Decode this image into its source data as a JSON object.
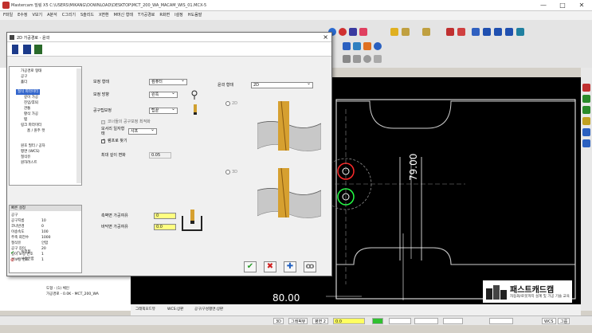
{
  "window": {
    "title": "Mastercam 밀링 X5  C:\\USERS\\MIKANG\\DOWNLOAD\\DESKTOP\\MCT_200_WA_MACAM_WIS_01.MCX-5",
    "minimize": "—",
    "maximize": "□",
    "close": "✕"
  },
  "menu": [
    "F파일",
    "E수정",
    "V보기",
    "A분석",
    "C그리기",
    "S솔리드",
    "X변환",
    "M머신 형태",
    "T가공경로",
    "R화면",
    "I설정",
    "H도움말"
  ],
  "dialog": {
    "title": "2D 가공경로 - 윤곽",
    "close": "×",
    "tree": [
      {
        "label": "가공경로 형태",
        "sel": false
      },
      {
        "label": "공구",
        "sel": false
      },
      {
        "label": "홀더",
        "sel": false
      },
      {
        "label": "절삭 파라미터",
        "sel": true
      },
      {
        "label": "깊이 가공",
        "sel": false
      },
      {
        "label": "진입/후퇴",
        "sel": false
      },
      {
        "label": "관통",
        "sel": false
      },
      {
        "label": "황삭 가공",
        "sel": false
      },
      {
        "label": "탭",
        "sel": false
      },
      {
        "label": "링크 파라미터",
        "sel": false
      },
      {
        "label": "홈 / 원주 컷",
        "sel": false
      },
      {
        "label": "원호 필터 / 공차",
        "sel": false
      },
      {
        "label": "평면 (WCS)",
        "sel": false
      },
      {
        "label": "절삭유",
        "sel": false
      },
      {
        "label": "원하려스트",
        "sel": false
      }
    ],
    "quick": {
      "header": "빠른 설정",
      "rows": [
        {
          "k": "공구",
          "v": ""
        },
        {
          "k": "공구지름",
          "v": "10"
        },
        {
          "k": "코너반경",
          "v": "0"
        },
        {
          "k": "이송속도",
          "v": "100"
        },
        {
          "k": "주축 회전수",
          "v": "1000"
        },
        {
          "k": "절삭유",
          "v": "안함"
        },
        {
          "k": "공구 길이",
          "v": "20"
        },
        {
          "k": "길이 보정 번호",
          "v": "1"
        },
        {
          "k": "경보정 번호",
          "v": "1"
        }
      ],
      "legend_edited": "= 수정됨",
      "legend_disabled": "= 사용안함"
    },
    "params": {
      "comp_type_label": "보정 형태",
      "comp_type_value": "컴퓨터",
      "comp_dir_label": "보정 방향",
      "comp_dir_value": "왼쪽",
      "tip_comp_label": "공구팁보정",
      "tip_comp_value": "팁끝",
      "roll_label": "코너들의 공구보정 최적화",
      "corner_label": "모서리 일자형태",
      "corner_value": "샤프",
      "infinite_label": "램프로 찾기",
      "max_depth_label": "최대 깊이 변화",
      "max_depth_value": "0.05",
      "contour_type_label": "윤곽 형태",
      "contour_type_value": "2D",
      "radio_2d": "2D",
      "radio_3d": "3D",
      "wall_stock_label": "측벽면 가공여유",
      "wall_stock_value": "0",
      "floor_stock_label": "바닥면 가공여유",
      "floor_stock_value": "0.0"
    },
    "actions": [
      {
        "name": "ok-button",
        "glyph": "✔",
        "color": "#2a9d2a"
      },
      {
        "name": "cancel-button",
        "glyph": "✖",
        "color": "#d02020"
      },
      {
        "name": "help-button",
        "glyph": "✚",
        "color": "#2060c0"
      },
      {
        "name": "options-button",
        "glyph": "ꝏ",
        "color": "#777"
      }
    ]
  },
  "tree_bottom": {
    "ops": [
      "도형 - (1) 체인",
      "가공경로 - 0.0K - MCT_200_WA"
    ]
  },
  "viewport": {
    "dim_vertical": "79.00",
    "dim_horizontal": "80.00",
    "ruler_labels": [
      "그래픽모드뷰",
      "WCS:상판",
      "공구/구성평면:상판"
    ]
  },
  "status": [
    "3D",
    "그래픽뷰",
    "평면 2",
    "0.0",
    "",
    "",
    "",
    "",
    "",
    "WCS",
    "그룹"
  ],
  "brand": {
    "title": "패스트캐드캠",
    "subtitle": "자동화/로봇까지 설계 및 가공 기술 교육"
  }
}
